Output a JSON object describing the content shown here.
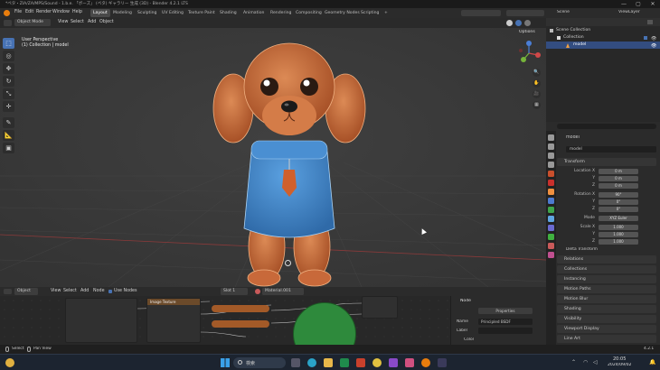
{
  "titlebar": {
    "title": "*ペタ・ZIA/ZA/MPS/Sound - 1.b.e. 「ボーズ」 (ペタ) ギャラリー 生成 (3D) - Blender 4.2.1 LTS",
    "min": "—",
    "max": "▢",
    "close": "✕"
  },
  "menubar": {
    "menus": [
      "File",
      "Edit",
      "Render",
      "Window",
      "Help"
    ],
    "workspaces": [
      "Layout",
      "Modeling",
      "Sculpting",
      "UV Editing",
      "Texture Paint",
      "Shading",
      "Animation",
      "Rendering",
      "Compositing",
      "Geometry Nodes",
      "Scripting"
    ],
    "active_workspace": "Layout",
    "scene": "Scene",
    "view_layer": "ViewLayer"
  },
  "viewport": {
    "mode": "Object Mode",
    "menus": [
      "View",
      "Select",
      "Add",
      "Object"
    ],
    "options_label": "Options",
    "info_line1": "User Perspective",
    "info_line2": "(1) Collection | model"
  },
  "outliner": {
    "rows": [
      {
        "label": "Scene Collection",
        "indent": 0,
        "selected": false
      },
      {
        "label": "Collection",
        "indent": 1,
        "selected": false
      },
      {
        "label": "model",
        "indent": 2,
        "selected": true
      }
    ]
  },
  "properties": {
    "object_name": "model",
    "mesh_name": "model",
    "transform_label": "Transform",
    "location_label": "Location X",
    "rotation_label": "Rotation X",
    "scale_label": "Scale X",
    "mode_label": "Mode",
    "mode_value": "XYZ Euler",
    "loc": [
      "0 m",
      "0 m",
      "0 m"
    ],
    "rot": [
      "90°",
      "0°",
      "0°"
    ],
    "scale": [
      "1.000",
      "1.000",
      "1.000"
    ],
    "y_label": "Y",
    "z_label": "Z",
    "delta_label": "Delta Transform",
    "panels": [
      "Relations",
      "Collections",
      "Instancing",
      "Motion Paths",
      "Motion Blur",
      "Shading",
      "Visibility",
      "Viewport Display",
      "Line Art",
      "Custom Properties"
    ]
  },
  "bottom": {
    "editor": "Object",
    "menus": [
      "View",
      "Select",
      "Add",
      "Node"
    ],
    "use_nodes": "Use Nodes",
    "slot": "Slot 1",
    "material": "Material.001",
    "node_panel_title": "Node",
    "node_name_label": "Name",
    "node_name_value": "Principled BSDF",
    "node_label_label": "Label",
    "node_tab": "Properties",
    "color_label": "Color",
    "bc_node": "Image Texture",
    "obj_label": "model",
    "mat_label": "Material.001"
  },
  "status": {
    "left": "Select",
    "mid": "Pan View",
    "right": "4.2.1"
  },
  "taskbar": {
    "search": "検索",
    "time": "20:05",
    "date": "2024/09/02"
  },
  "colors": {
    "accent": "#4772b3",
    "viewport_bg": "#3a3a3a",
    "dog_fur": "#c9683a",
    "sweater": "#3f86c9",
    "node_green": "#2e8a3c",
    "node_orange": "#a35a28"
  }
}
